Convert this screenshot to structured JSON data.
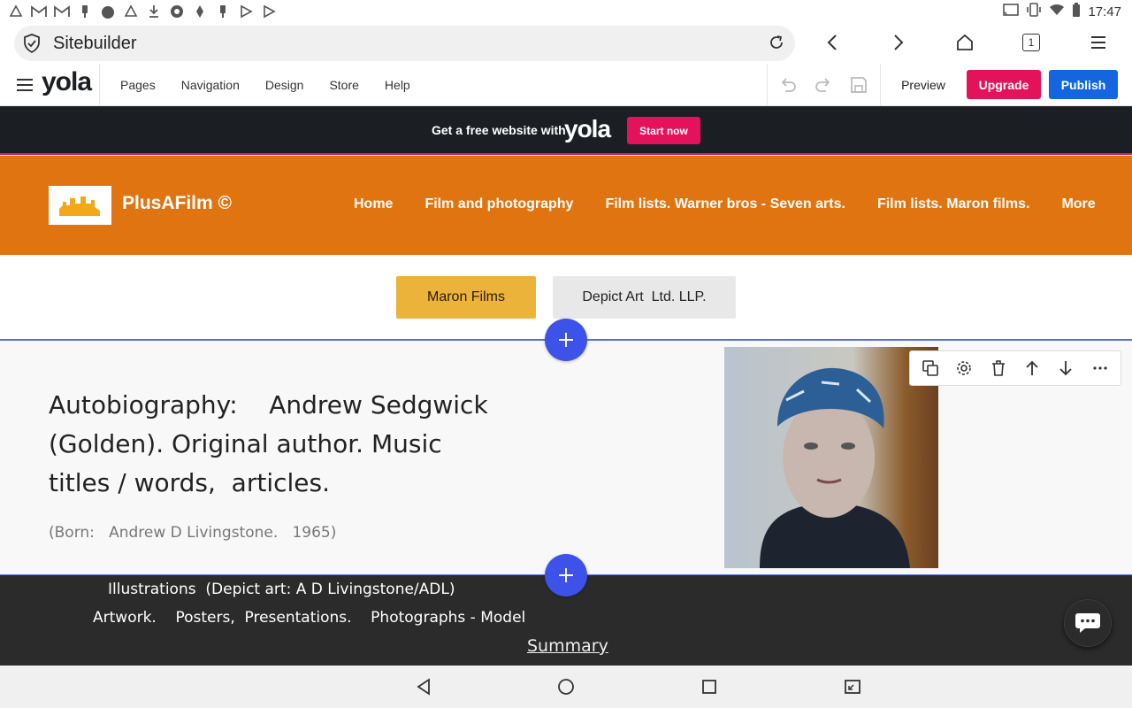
{
  "status_bar": {
    "time": "17:47",
    "left_icons": [
      "triangle-icon",
      "gmail-icon",
      "gmail-icon",
      "usb-icon",
      "android-icon",
      "triangle-icon",
      "download-icon",
      "aperture-icon",
      "cloud-icon",
      "usb-icon",
      "play-icon",
      "play-icon"
    ],
    "right_icons": [
      "cast-icon",
      "vibrate-icon",
      "wifi-icon",
      "battery-icon"
    ]
  },
  "browser": {
    "url_title": "Sitebuilder",
    "tab_count": "1"
  },
  "yola_toolbar": {
    "logo": "yola",
    "menu": [
      "Pages",
      "Navigation",
      "Design",
      "Store",
      "Help"
    ],
    "preview_label": "Preview",
    "upgrade_label": "Upgrade",
    "publish_label": "Publish"
  },
  "promo": {
    "text": "Get a free website with",
    "logo": "yola",
    "button": "Start now"
  },
  "site": {
    "title": "PlusAFilm ©",
    "nav": [
      "Home",
      "Film and photography",
      "Film lists. Warner bros - Seven arts.",
      "Film lists. Maron films.",
      "More"
    ]
  },
  "tabs": {
    "maron": "Maron Films",
    "depict": "Depict Art  Ltd. LLP."
  },
  "content": {
    "headline": "Autobiography:    Andrew Sedgwick (Golden). Original author. Music titles / words,  articles.",
    "born": "(Born:   Andrew D Livingstone.   1965)"
  },
  "dark_section": {
    "line1": "Illustrations  (Depict art: A D Livingstone/ADL)",
    "line2": "Artwork.    Posters,  Presentations.    Photographs - Model",
    "summary": "Summary"
  },
  "colors": {
    "header_orange": "#e07411",
    "upgrade_pink": "#e3125a",
    "publish_blue": "#1466e0",
    "tab_yellow": "#ecb33a",
    "add_blue": "#3c52e8",
    "dark_bg": "#2b2b2b"
  }
}
